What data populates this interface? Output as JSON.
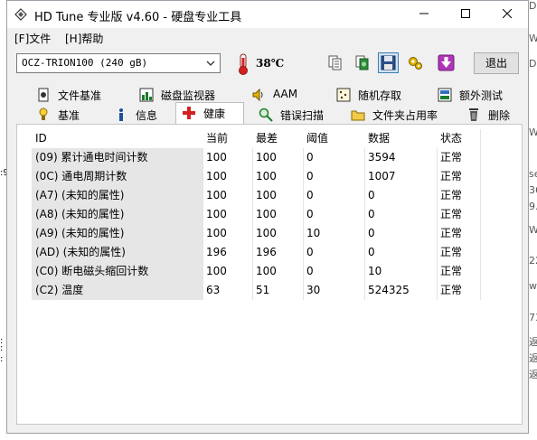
{
  "window": {
    "title": "HD Tune 专业版 v4.60 - 硬盘专业工具",
    "minimize": "—",
    "maximize": "☐",
    "close": "✕"
  },
  "menu": [
    {
      "label": "[F]文件"
    },
    {
      "label": "[H]帮助"
    }
  ],
  "toolbar": {
    "drive": "OCZ-TRION100 (240 gB)",
    "temperature": "38℃",
    "exit_label": "退出",
    "icons": [
      "copy-text-icon",
      "copy-screenshot-icon",
      "save-icon",
      "options-icon",
      "download-icon"
    ]
  },
  "tabs": {
    "row1": [
      {
        "label": "文件基准",
        "icon": "file-benchmark-icon"
      },
      {
        "label": "磁盘监视器",
        "icon": "disk-monitor-icon"
      },
      {
        "label": "AAM",
        "icon": "speaker-icon"
      },
      {
        "label": "随机存取",
        "icon": "random-access-icon"
      },
      {
        "label": "额外测试",
        "icon": "extra-tests-icon"
      }
    ],
    "row2": [
      {
        "label": "基准",
        "icon": "benchmark-icon"
      },
      {
        "label": "信息",
        "icon": "info-icon"
      },
      {
        "label": "健康",
        "icon": "health-icon"
      },
      {
        "label": "错误扫描",
        "icon": "error-scan-icon"
      },
      {
        "label": "文件夹占用率",
        "icon": "folder-usage-icon"
      },
      {
        "label": "删除",
        "icon": "erase-icon"
      }
    ],
    "selected": "健康"
  },
  "health_table": {
    "headers": [
      "ID",
      "当前",
      "最差",
      "阈值",
      "数据",
      "状态"
    ],
    "rows": [
      [
        "(09) 累计通电时间计数",
        "100",
        "100",
        "0",
        "3594",
        "正常"
      ],
      [
        "(0C) 通电周期计数",
        "100",
        "100",
        "0",
        "1007",
        "正常"
      ],
      [
        "(A7) (未知的属性)",
        "100",
        "100",
        "0",
        "0",
        "正常"
      ],
      [
        "(A8) (未知的属性)",
        "100",
        "100",
        "0",
        "0",
        "正常"
      ],
      [
        "(A9) (未知的属性)",
        "100",
        "100",
        "10",
        "0",
        "正常"
      ],
      [
        "(AD) (未知的属性)",
        "196",
        "196",
        "0",
        "0",
        "正常"
      ],
      [
        "(C0) 断电磁头缩回计数",
        "100",
        "100",
        "0",
        "10",
        "正常"
      ],
      [
        "(C2) 温度",
        "63",
        "51",
        "30",
        "524325",
        "正常"
      ]
    ]
  },
  "background_left": [
    ":9",
    ":",
    ":",
    ":"
  ],
  "background_right": [
    "D",
    "W",
    "D",
    "W",
    "se",
    "36",
    "9.",
    "W",
    "22",
    "w",
    "73",
    "返",
    "返",
    "返"
  ]
}
